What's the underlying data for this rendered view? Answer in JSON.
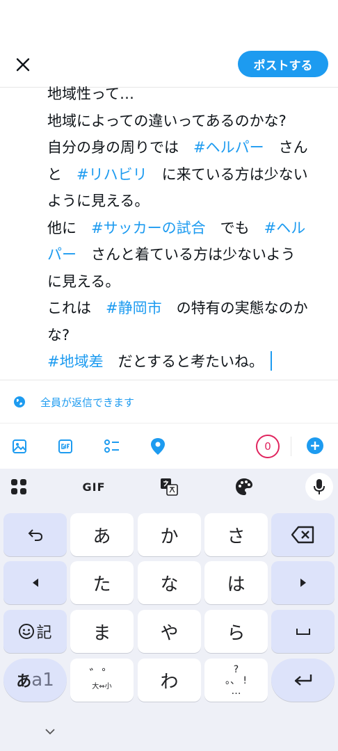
{
  "header": {
    "post_button_label": "ポストする"
  },
  "compose": {
    "lines": [
      [
        {
          "t": "地域性って…",
          "tag": false
        }
      ],
      [
        {
          "t": "地域によっての違いってあるのかな?",
          "tag": false
        }
      ],
      [
        {
          "t": "自分の身の周りでは　",
          "tag": false
        },
        {
          "t": "#ヘルパー",
          "tag": true
        },
        {
          "t": "　さん",
          "tag": false
        }
      ],
      [
        {
          "t": "と　",
          "tag": false
        },
        {
          "t": "#リハビリ",
          "tag": true
        },
        {
          "t": "　に来ている方は少ない",
          "tag": false
        }
      ],
      [
        {
          "t": "ように見える。",
          "tag": false
        }
      ],
      [
        {
          "t": "他に　",
          "tag": false
        },
        {
          "t": "#サッカーの試合",
          "tag": true
        },
        {
          "t": "　でも　",
          "tag": false
        },
        {
          "t": "#ヘル",
          "tag": true
        }
      ],
      [
        {
          "t": "パー",
          "tag": true
        },
        {
          "t": "　さんと着ている方は少ないよう",
          "tag": false
        }
      ],
      [
        {
          "t": "に見える。",
          "tag": false
        }
      ],
      [
        {
          "t": "これは　",
          "tag": false
        },
        {
          "t": "#静岡市",
          "tag": true
        },
        {
          "t": "　の特有の実態なのか",
          "tag": false
        }
      ],
      [
        {
          "t": "な?",
          "tag": false
        }
      ],
      [
        {
          "t": "#地域差",
          "tag": true
        },
        {
          "t": "　だとすると考たいね。",
          "tag": false
        }
      ]
    ]
  },
  "reply_setting": {
    "label": "全員が返信できます"
  },
  "toolbar": {
    "char_counter": "0"
  },
  "keyboard": {
    "toolbar": {
      "gif_label": "GIF"
    },
    "keys": {
      "a": "あ",
      "ka": "か",
      "sa": "さ",
      "ta": "た",
      "na": "な",
      "ha": "は",
      "ma": "ま",
      "ya": "や",
      "ra": "ら",
      "wa": "わ",
      "emoji_symbol": "記",
      "mode_kana": "あ",
      "mode_alpha": "a1",
      "dakuten_top": "゛゜",
      "dakuten_bottom": "大⇔小",
      "punct_top": "?",
      "punct_mid": "。、 !",
      "punct_bottom": "…"
    }
  },
  "colors": {
    "accent": "#1d9bf0",
    "counter_warning": "#e0245e",
    "keyboard_bg": "#eef0f7",
    "function_key": "#dde3fa"
  }
}
